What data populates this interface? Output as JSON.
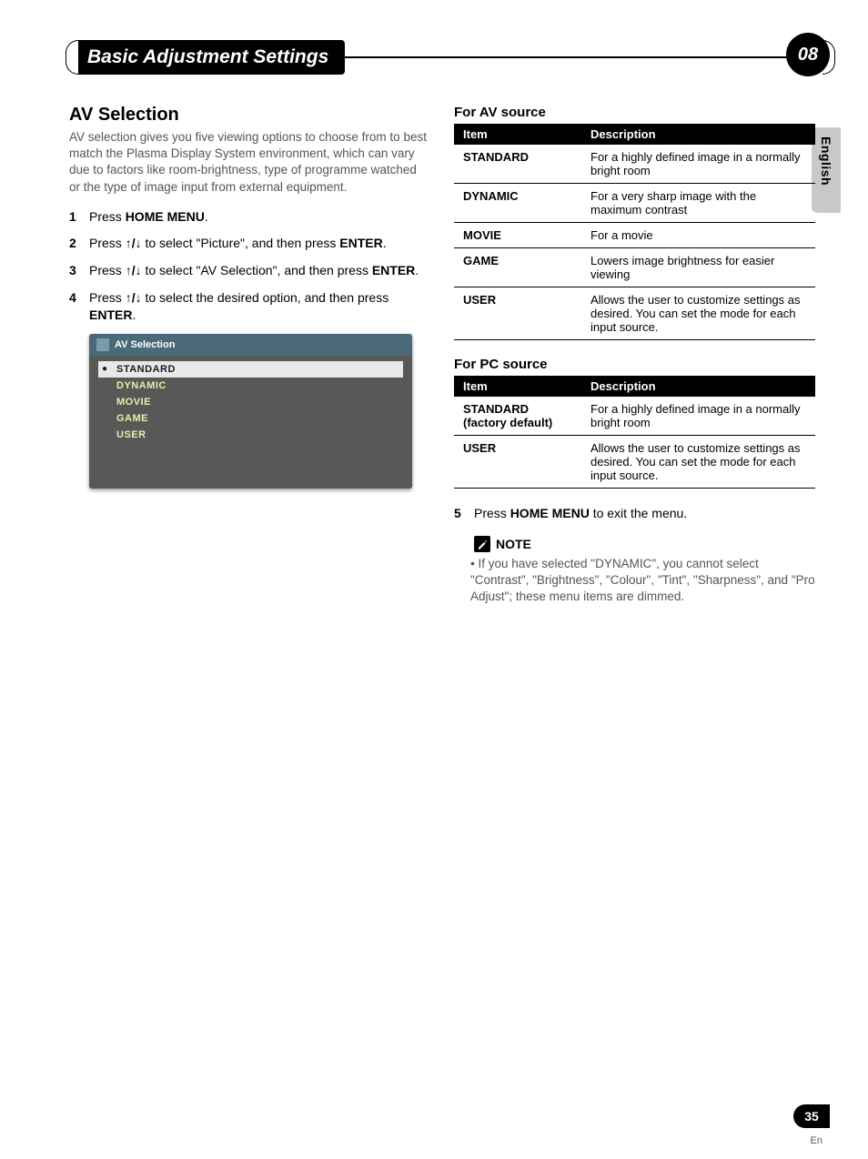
{
  "header": {
    "title": "Basic Adjustment Settings",
    "chapter": "08"
  },
  "lang_tab": "English",
  "left": {
    "section_title": "AV Selection",
    "intro": "AV selection gives you five viewing options to choose from to best match the Plasma Display System environment, which can vary due to factors like room-brightness, type of programme watched or the type of image input from external equipment.",
    "steps": [
      {
        "num": "1",
        "prefix": "Press ",
        "bold1": "HOME MENU",
        "suffix": "."
      },
      {
        "num": "2",
        "prefix": "Press ",
        "arrows": "↑/↓",
        "mid": " to select \"Picture\", and then press ",
        "bold1": "ENTER",
        "suffix": "."
      },
      {
        "num": "3",
        "prefix": "Press ",
        "arrows": "↑/↓",
        "mid": " to select \"AV Selection\", and then press ",
        "bold1": "ENTER",
        "suffix": "."
      },
      {
        "num": "4",
        "prefix": "Press ",
        "arrows": "↑/↓",
        "mid": " to select the desired option, and then press ",
        "bold1": "ENTER",
        "suffix": "."
      }
    ],
    "osd": {
      "title": "AV Selection",
      "items": [
        "STANDARD",
        "DYNAMIC",
        "MOVIE",
        "GAME",
        "USER"
      ]
    }
  },
  "right": {
    "table1": {
      "heading": "For AV source",
      "headers": [
        "Item",
        "Description"
      ],
      "rows": [
        {
          "item": "STANDARD",
          "desc": "For a highly defined image in a normally bright room"
        },
        {
          "item": "DYNAMIC",
          "desc": "For a very sharp image with the maximum contrast"
        },
        {
          "item": "MOVIE",
          "desc": "For a movie"
        },
        {
          "item": "GAME",
          "desc": "Lowers image brightness for easier viewing"
        },
        {
          "item": "USER",
          "desc": "Allows the user to customize settings as desired. You can set the mode for each input source."
        }
      ]
    },
    "table2": {
      "heading": "For PC source",
      "headers": [
        "Item",
        "Description"
      ],
      "rows": [
        {
          "item": "STANDARD\n(factory default)",
          "desc": "For a highly defined image in a normally bright room"
        },
        {
          "item": "USER",
          "desc": "Allows the user to customize settings as desired. You can set the mode for each input source."
        }
      ]
    },
    "step5": {
      "num": "5",
      "prefix": "Press ",
      "bold1": "HOME MENU",
      "suffix": " to exit the menu."
    },
    "note_label": "NOTE",
    "note_body": "• If you have selected \"DYNAMIC\", you cannot select \"Contrast\", \"Brightness\", \"Colour\", \"Tint\", \"Sharpness\", and \"Pro Adjust\"; these menu items are dimmed."
  },
  "footer": {
    "page": "35",
    "lang": "En"
  }
}
